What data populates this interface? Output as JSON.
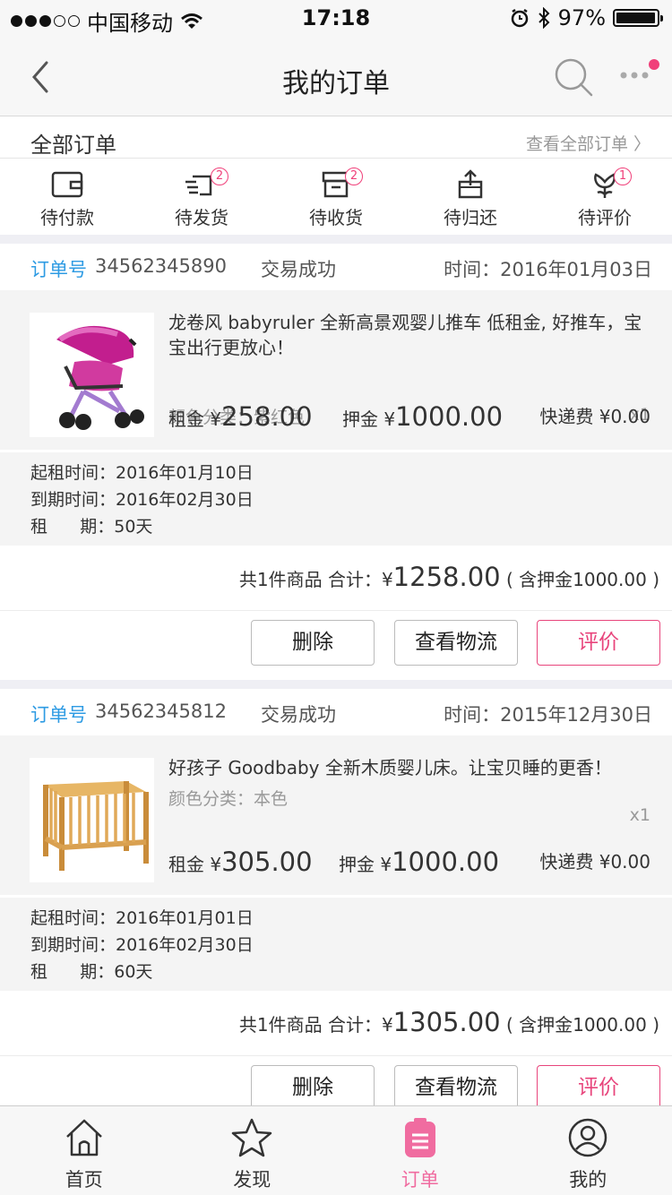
{
  "status_bar": {
    "carrier": "中国移动",
    "time": "17:18",
    "battery": "97%"
  },
  "nav": {
    "title": "我的订单"
  },
  "all_orders": {
    "title": "全部订单",
    "link": "查看全部订单 〉"
  },
  "status_tabs": [
    {
      "label": "待付款",
      "icon": "wallet-icon",
      "badge": ""
    },
    {
      "label": "待发货",
      "icon": "shipping-icon",
      "badge": "2"
    },
    {
      "label": "待收货",
      "icon": "box-icon",
      "badge": "2"
    },
    {
      "label": "待归还",
      "icon": "return-box-icon",
      "badge": ""
    },
    {
      "label": "待评价",
      "icon": "flower-icon",
      "badge": "1"
    }
  ],
  "orders": [
    {
      "order_label": "订单号",
      "order_no": "34562345890",
      "status": "交易成功",
      "time": "时间：2016年01月03日",
      "product_name": "龙卷风 babyruler  全新高景观婴儿推车 低租金, 好推车，宝宝出行更放心！",
      "color": "颜色分类：紫红色",
      "qty": "x1",
      "rent_label": "租金 ¥",
      "rent": "258.00",
      "deposit_label": "押金 ¥",
      "deposit": "1000.00",
      "shipping": "快递费 ¥0.00",
      "start": "起租时间：2016年01月10日",
      "end": "到期时间：2016年02月30日",
      "period": "租      期：50天",
      "total_prefix": "共1件商品  合计：¥",
      "total": "1258.00",
      "total_suffix": "( 含押金1000.00 )",
      "btn_delete": "删除",
      "btn_logistics": "查看物流",
      "btn_review": "评价"
    },
    {
      "order_label": "订单号",
      "order_no": "34562345812",
      "status": "交易成功",
      "time": "时间：2015年12月30日",
      "product_name": "好孩子 Goodbaby  全新木质婴儿床。让宝贝睡的更香！",
      "color": "颜色分类：本色",
      "qty": "x1",
      "rent_label": "租金 ¥",
      "rent": "305.00",
      "deposit_label": "押金 ¥",
      "deposit": "1000.00",
      "shipping": "快递费 ¥0.00",
      "start": "起租时间：2016年01月01日",
      "end": "到期时间：2016年02月30日",
      "period": "租      期：60天",
      "total_prefix": "共1件商品  合计：¥",
      "total": "1305.00",
      "total_suffix": "( 含押金1000.00 )",
      "btn_delete": "删除",
      "btn_logistics": "查看物流",
      "btn_review": "评价"
    }
  ],
  "tabbar": [
    {
      "label": "首页",
      "icon": "home-icon"
    },
    {
      "label": "发现",
      "icon": "star-icon"
    },
    {
      "label": "订单",
      "icon": "order-icon",
      "active": true
    },
    {
      "label": "我的",
      "icon": "profile-icon"
    }
  ],
  "colors": {
    "accent": "#f06ca0",
    "link_blue": "#2e9be3",
    "review_pink": "#e8457c"
  }
}
